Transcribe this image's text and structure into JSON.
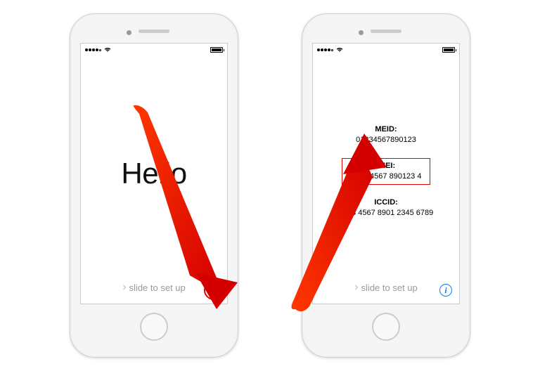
{
  "left_screen": {
    "hello_text": "Hello",
    "slide_text": "slide to set up"
  },
  "right_screen": {
    "slide_text": "slide to set up",
    "meid": {
      "label": "MEID:",
      "value": "01234567890123"
    },
    "imei": {
      "label": "IMEI:",
      "value": "01 234567 890123 4"
    },
    "iccid": {
      "label": "ICCID:",
      "value": "0123 4567 8901 2345 6789"
    }
  }
}
